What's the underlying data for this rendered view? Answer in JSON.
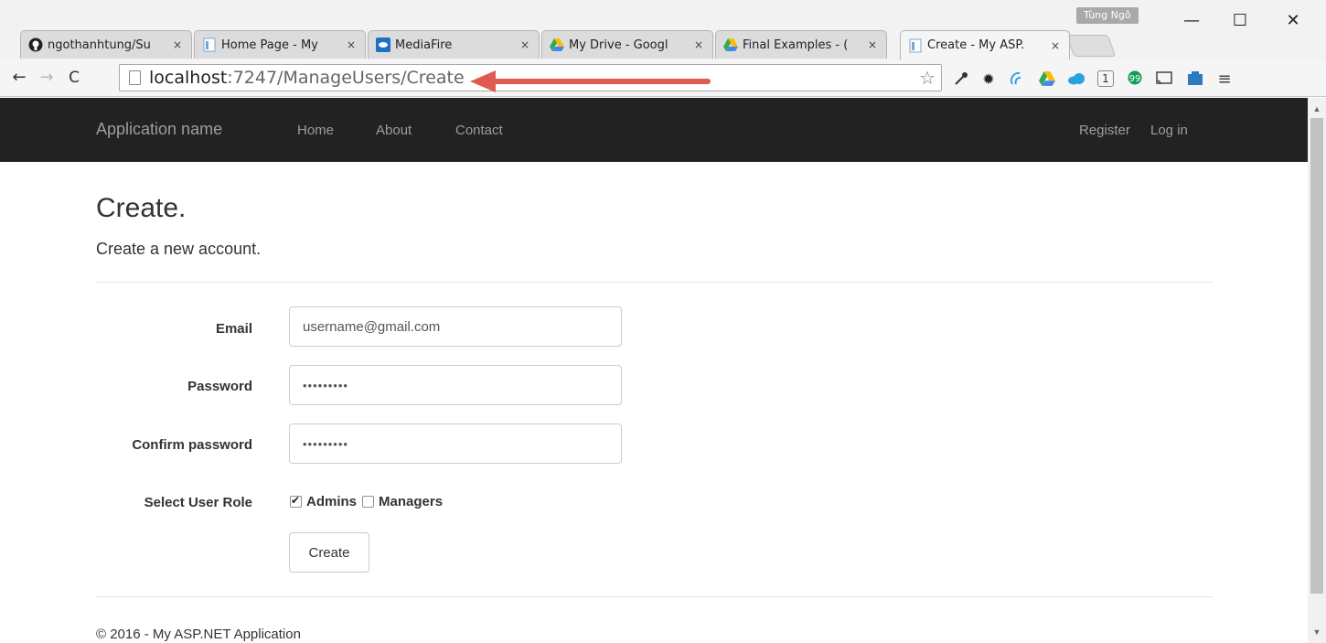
{
  "browser": {
    "tabs": [
      {
        "title": "ngothanhtung/Su",
        "icon": "github-icon",
        "active": false
      },
      {
        "title": "Home Page - My",
        "icon": "page-icon",
        "active": false
      },
      {
        "title": "MediaFire",
        "icon": "mediafire-icon",
        "active": false
      },
      {
        "title": "My Drive - Googl",
        "icon": "google-drive-icon",
        "active": false
      },
      {
        "title": "Final Examples - (",
        "icon": "google-drive-icon",
        "active": false
      },
      {
        "title": "Create - My ASP.",
        "icon": "page-icon",
        "active": true
      }
    ],
    "tab_close": "×",
    "profile_name": "Tùng Ngô",
    "window_controls": {
      "minimize": "—",
      "maximize": "☐",
      "close": "✕"
    },
    "address": {
      "host": "localhost",
      "path": ":7247/ManageUsers/Create"
    },
    "annotation_arrow_color": "#e05a4f"
  },
  "site": {
    "brand": "Application name",
    "nav_left": [
      "Home",
      "About",
      "Contact"
    ],
    "nav_right": [
      "Register",
      "Log in"
    ]
  },
  "form": {
    "heading": "Create.",
    "subheading": "Create a new account.",
    "email_label": "Email",
    "email_value": "username@gmail.com",
    "password_label": "Password",
    "password_value": "•••••••••",
    "confirm_label": "Confirm password",
    "confirm_value": "•••••••••",
    "role_label": "Select User Role",
    "roles": [
      {
        "name": "Admins",
        "checked": true
      },
      {
        "name": "Managers",
        "checked": false
      }
    ],
    "submit_label": "Create"
  },
  "footer": {
    "text": "© 2016 - My ASP.NET Application"
  }
}
